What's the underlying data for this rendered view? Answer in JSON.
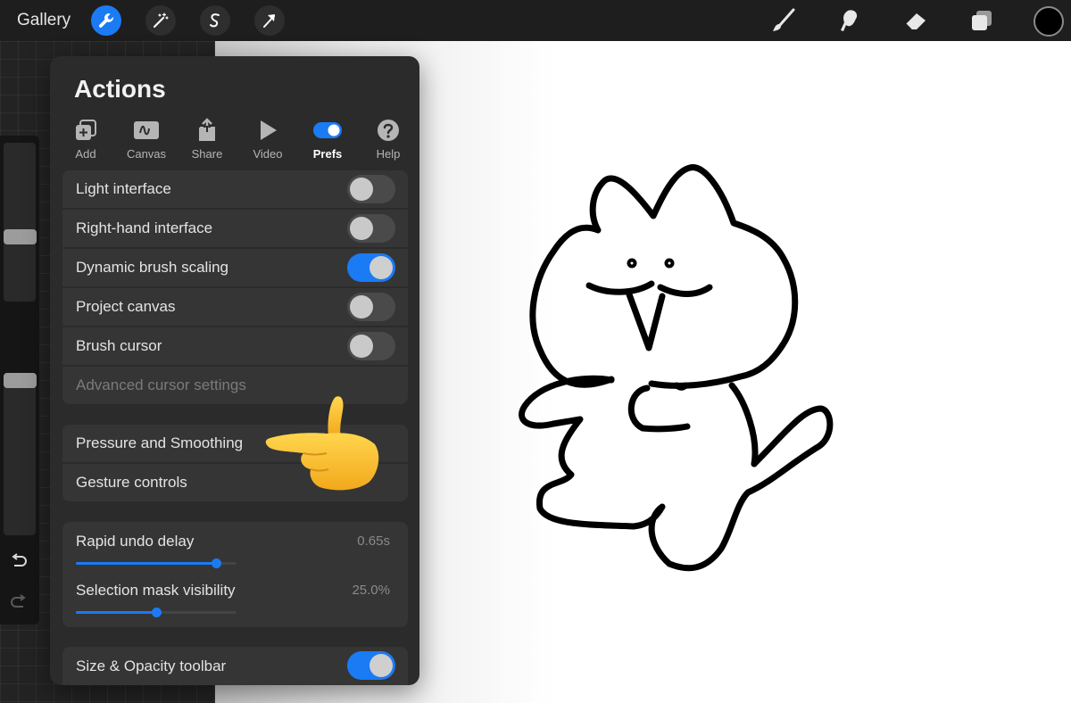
{
  "topbar": {
    "gallery_label": "Gallery",
    "tools_left": [
      "wrench-icon",
      "magic-wand-icon",
      "selection-s-icon",
      "transform-arrow-icon"
    ],
    "tools_right": [
      "brush-icon",
      "smudge-icon",
      "eraser-icon",
      "layers-icon"
    ],
    "active_color": "#000000",
    "accent_color": "#1a7bf5"
  },
  "sidebar": {
    "size_level": 0.4,
    "opacity_level": 0.1,
    "icons": [
      "modify-square-icon",
      "undo-icon",
      "redo-icon"
    ]
  },
  "panel": {
    "title": "Actions",
    "tabs": [
      {
        "label": "Add",
        "icon": "add-icon",
        "active": false
      },
      {
        "label": "Canvas",
        "icon": "canvas-icon",
        "active": false
      },
      {
        "label": "Share",
        "icon": "share-icon",
        "active": false
      },
      {
        "label": "Video",
        "icon": "video-play-icon",
        "active": false
      },
      {
        "label": "Prefs",
        "icon": "prefs-toggle-icon",
        "active": true
      },
      {
        "label": "Help",
        "icon": "help-icon",
        "active": false
      }
    ],
    "toggles": [
      {
        "label": "Light interface",
        "on": false
      },
      {
        "label": "Right-hand interface",
        "on": false
      },
      {
        "label": "Dynamic brush scaling",
        "on": true
      },
      {
        "label": "Project canvas",
        "on": false
      },
      {
        "label": "Brush cursor",
        "on": false
      }
    ],
    "advanced_cursor": "Advanced cursor settings",
    "pressure_smoothing": "Pressure and Smoothing",
    "gesture_controls": "Gesture controls",
    "sliders": [
      {
        "label": "Rapid undo delay",
        "value": "0.65s",
        "fraction": 0.87
      },
      {
        "label": "Selection mask visibility",
        "value": "25.0%",
        "fraction": 0.5
      }
    ],
    "size_opacity": {
      "label": "Size & Opacity toolbar",
      "on": true
    }
  },
  "decor": {
    "pointing_hand": "pointing-hand-emoji",
    "drawing": "cat-drawing"
  }
}
